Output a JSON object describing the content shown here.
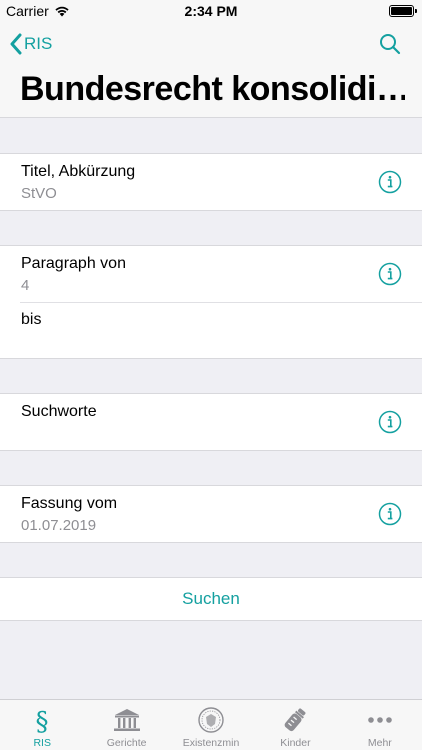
{
  "status_bar": {
    "carrier": "Carrier",
    "time": "2:34 PM"
  },
  "nav": {
    "back_label": "RIS",
    "title": "Bundesrecht konsolidi…"
  },
  "sections": [
    {
      "rows": [
        {
          "label": "Titel, Abkürzung",
          "value": "StVO"
        }
      ]
    },
    {
      "rows": [
        {
          "label": "Paragraph von",
          "value": "4"
        },
        {
          "label": "bis",
          "value": ""
        }
      ]
    },
    {
      "rows": [
        {
          "label": "Suchworte",
          "value": ""
        }
      ]
    },
    {
      "rows": [
        {
          "label": "Fassung vom",
          "value": "01.07.2019"
        }
      ]
    }
  ],
  "search_button": "Suchen",
  "tabs": [
    {
      "label": "RIS",
      "icon": "paragraph-icon",
      "active": true
    },
    {
      "label": "Gerichte",
      "icon": "courthouse-icon",
      "active": false
    },
    {
      "label": "Existenzmin",
      "icon": "seal-icon",
      "active": false
    },
    {
      "label": "Kinder",
      "icon": "baby-bottle-icon",
      "active": false
    },
    {
      "label": "Mehr",
      "icon": "more-icon",
      "active": false
    }
  ],
  "colors": {
    "accent": "#14a0a0",
    "inactive": "#8e8e93",
    "background": "#efeff4"
  }
}
